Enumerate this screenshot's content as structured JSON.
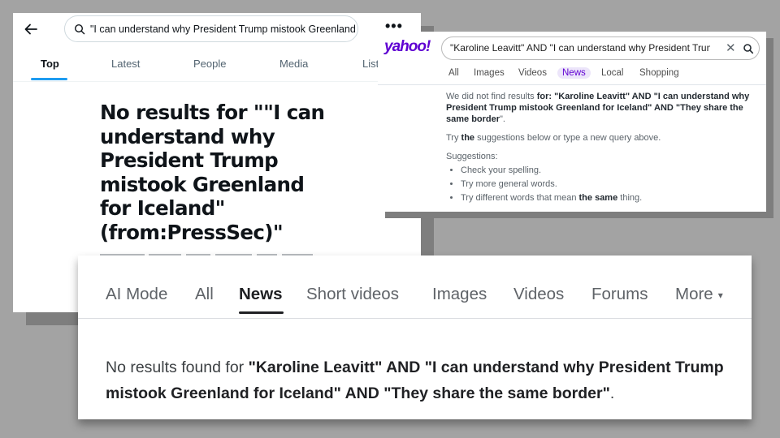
{
  "x": {
    "search_value": "\"I can understand why President Trump mistook Greenland for Iceland\" (from:PressSec)",
    "tabs": [
      "Top",
      "Latest",
      "People",
      "Media",
      "Lists"
    ],
    "more_label": "•••",
    "headline": "No results for \"\"I can understand why President Trump mistook Greenland for Iceland\" (from:PressSec)\""
  },
  "yahoo": {
    "logo": "yahoo!",
    "search_value": "\"Karoline Leavitt\" AND \"I can understand why President Trump mistook Greenland for Iceland\" AND \"They share the same border\"",
    "clear_label": "✕",
    "tabs": [
      "All",
      "Images",
      "Videos",
      "News",
      "Local",
      "Shopping"
    ],
    "no_results_prefix": "We did not find results ",
    "no_results_for": "for: ",
    "no_results_query": "\"Karoline Leavitt\" AND \"I can understand why President Trump mistook Greenland for Iceland\" AND \"They share the same border",
    "no_results_suffix": "\".",
    "try_prefix": "Try ",
    "try_bold": "the",
    "try_suffix": " suggestions below or type a new query above.",
    "suggestions_label": "Suggestions:",
    "suggestion_1": "Check your spelling.",
    "suggestion_2": "Try more general words.",
    "suggestion_3_prefix": "Try different words that mean ",
    "suggestion_3_bold": "the same",
    "suggestion_3_suffix": " thing."
  },
  "google": {
    "tabs": [
      "AI Mode",
      "All",
      "News",
      "Short videos",
      "Images",
      "Videos",
      "Forums",
      "More"
    ],
    "more_caret": "▾",
    "message_prefix": "No results found for ",
    "message_query": "\"Karoline Leavitt\" AND \"I can understand why President Trump mistook Greenland for Iceland\" AND \"They share the same border\"",
    "message_suffix": "."
  },
  "colors": {
    "x_accent": "#1d9bf0",
    "yahoo_purple": "#6001d2",
    "background_gray": "#a3a3a3"
  }
}
